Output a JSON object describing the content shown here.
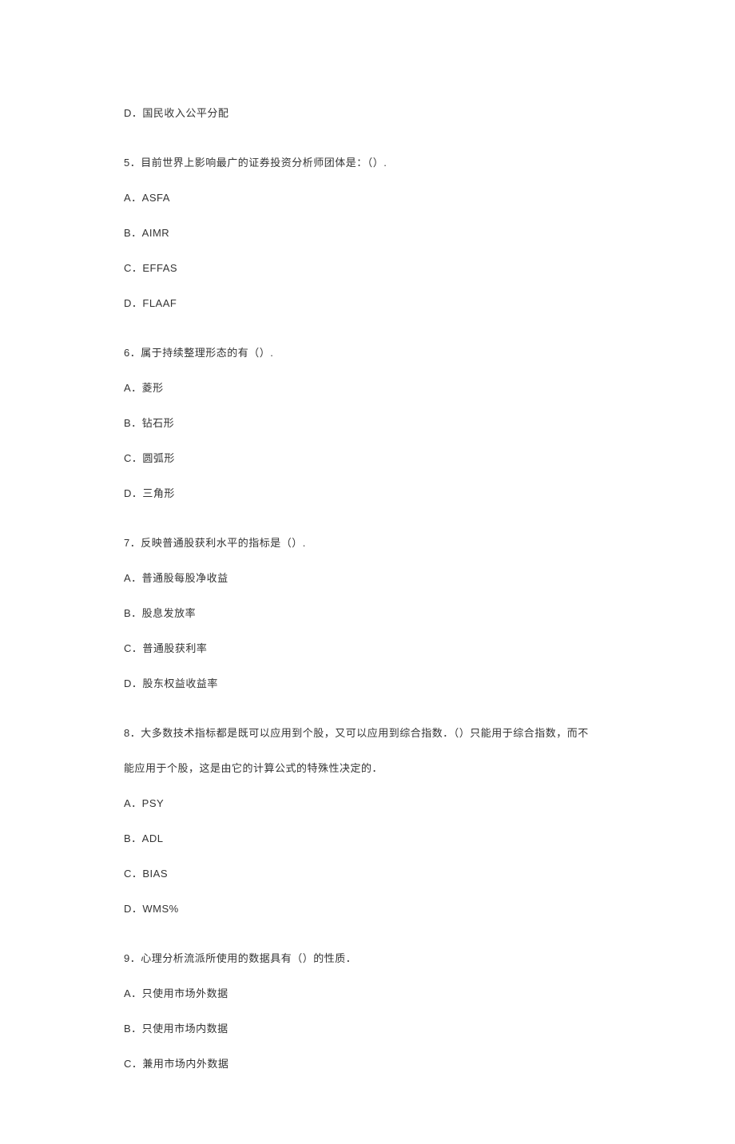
{
  "items": [
    {
      "type": "option",
      "lines": [
        "D．国民收入公平分配"
      ]
    },
    {
      "type": "question",
      "stem": [
        "5．目前世界上影响最广的证券投资分析师团体是：（）."
      ],
      "options": [
        "A．ASFA",
        "B．AIMR",
        "C．EFFAS",
        "D．FLAAF"
      ]
    },
    {
      "type": "question",
      "stem": [
        "6．属于持续整理形态的有（）."
      ],
      "options": [
        "A．菱形",
        "B．钻石形",
        "C．圆弧形",
        "D．三角形"
      ]
    },
    {
      "type": "question",
      "stem": [
        "7．反映普通股获利水平的指标是（）."
      ],
      "options": [
        "A．普通股每股净收益",
        "B．股息发放率",
        "C．普通股获利率",
        "D．股东权益收益率"
      ]
    },
    {
      "type": "question",
      "stem": [
        "8．大多数技术指标都是既可以应用到个股，又可以应用到综合指数．（）只能用于综合指数，而不",
        "能应用于个股，这是由它的计算公式的特殊性决定的．"
      ],
      "options": [
        "A．PSY",
        "B．ADL",
        "C．BIAS",
        "D．WMS%"
      ]
    },
    {
      "type": "question",
      "stem": [
        "9．心理分析流派所使用的数据具有（）的性质．"
      ],
      "options": [
        "A．只使用市场外数据",
        "B．只使用市场内数据",
        "C．兼用市场内外数据"
      ]
    }
  ]
}
